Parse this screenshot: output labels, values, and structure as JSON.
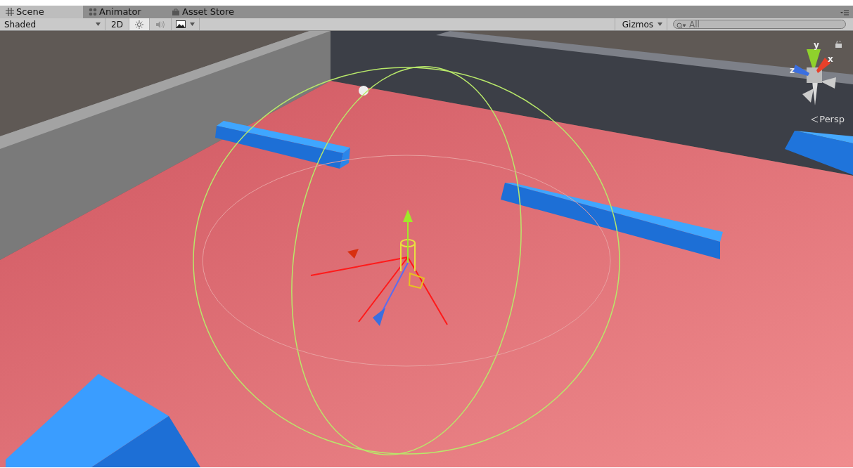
{
  "tabs": [
    {
      "label": "Scene",
      "kind": "grid",
      "selected": true
    },
    {
      "label": "Animator",
      "kind": "nodes",
      "selected": false
    },
    {
      "label": "Asset Store",
      "kind": "bag",
      "selected": false
    }
  ],
  "toolbar": {
    "draw_mode": "Shaded",
    "mode_2d": {
      "label": "2D",
      "on": false
    },
    "lighting_on": true,
    "audio_on": false,
    "gizmos": "Gizmos",
    "search": {
      "placeholder": "All"
    }
  },
  "scene_gizmo": {
    "axes": [
      {
        "label": "y",
        "color": "#8fd12c"
      },
      {
        "label": "x",
        "color": "#e8402a"
      },
      {
        "label": "z",
        "color": "#3b6fe0"
      }
    ],
    "projection": "Persp"
  }
}
